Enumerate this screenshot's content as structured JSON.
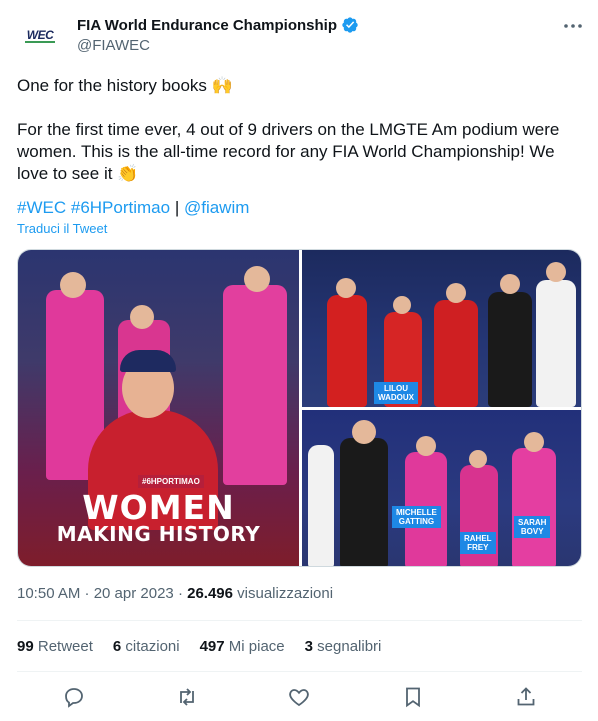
{
  "author": {
    "display_name": "FIA World Endurance Championship",
    "handle": "@FIAWEC",
    "avatar_text": "WEC"
  },
  "tweet": {
    "line1": "One for the history books 🙌",
    "line2": "For the first time ever, 4 out of 9 drivers on the LMGTE Am podium were women. This is the all-time record for any FIA World Championship! We love to see it 👏",
    "hashtag1": "#WEC",
    "hashtag2": "#6HPortimao",
    "separator": "|",
    "mention": "@fiawim",
    "translate": "Traduci il Tweet"
  },
  "media": {
    "left_title_1": "WOMEN",
    "left_title_2": "MAKING HISTORY",
    "left_hashtag": "#6HPORTIMAO",
    "tr_tag_1": "LILOU",
    "tr_tag_2": "WADOUX",
    "br_tag1_a": "MICHELLE",
    "br_tag1_b": "GATTING",
    "br_tag2_a": "RAHEL",
    "br_tag2_b": "FREY",
    "br_tag3_a": "SARAH",
    "br_tag3_b": "BOVY"
  },
  "meta": {
    "time_date": "10:50 AM · 20 apr 2023 · ",
    "views_count": "26.496",
    "views_label": " visualizzazioni"
  },
  "stats": {
    "retweets_count": "99",
    "retweets_label": " Retweet",
    "quotes_count": "6",
    "quotes_label": " citazioni",
    "likes_count": "497",
    "likes_label": " Mi piace",
    "bookmarks_count": "3",
    "bookmarks_label": " segnalibri"
  },
  "colors": {
    "accent": "#1d9bf0",
    "text": "#0f1419",
    "secondary": "#536471"
  }
}
